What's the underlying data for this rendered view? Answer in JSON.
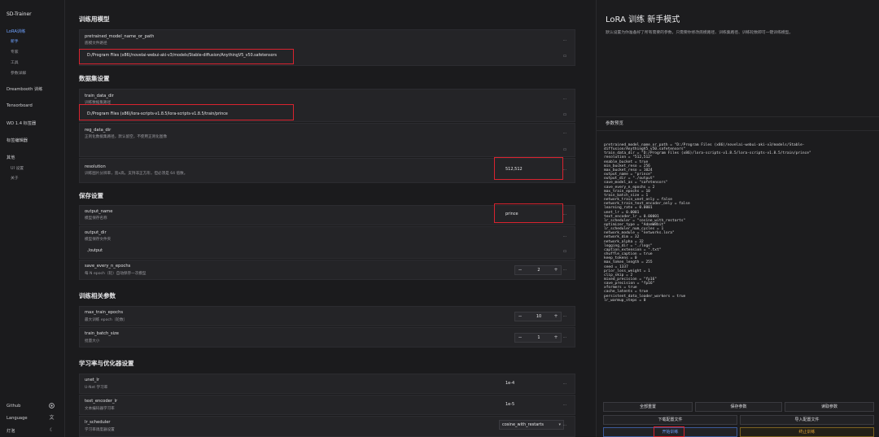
{
  "sidebar": {
    "brand": "SD-Trainer",
    "lora": "LoRA训练",
    "lora_subs": [
      "新手",
      "专家",
      "工具",
      "参数详解"
    ],
    "dreambooth": "Dreambooth 训练",
    "tensorboard": "Tensorboard",
    "wd": "WD 1.4 标签器",
    "tag_editor": "标签编辑器",
    "other": "其他",
    "other_subs": [
      "UI 设置",
      "关于"
    ],
    "github": "Github",
    "language": "Language",
    "theme": "灯泡"
  },
  "main": {
    "sections": {
      "model": "训练用模型",
      "dataset": "数据集设置",
      "save": "保存设置",
      "train": "训练相关参数",
      "lr": "学习率与优化器设置"
    },
    "pretrained": {
      "key": "pretrained_model_name_or_path",
      "desc": "底模文件路径",
      "value": "D:/Program Files (x86)/novelai-webui-aki-v3/models/Stable-diffusion/AnythingV5_v50.safetensors"
    },
    "train_data_dir": {
      "key": "train_data_dir",
      "desc": "训练数据集路径",
      "value": "D:/Program Files (x86)/lora-scripts-v1.8.5/lora-scripts-v1.8.5/train/prince"
    },
    "reg_data_dir": {
      "key": "reg_data_dir",
      "desc": "正则化数据集路径，默认留空，不使用正则化图像"
    },
    "resolution": {
      "key": "resolution",
      "desc": "训练图片分辨率，宽x高。支持非正方形，但必须是 64 倍数。",
      "value": "512,512"
    },
    "output_name": {
      "key": "output_name",
      "desc": "模型保存名称",
      "value": "prince"
    },
    "output_dir": {
      "key": "output_dir",
      "desc": "模型保存文件夹",
      "value": "./output"
    },
    "save_every": {
      "key": "save_every_n_epochs",
      "desc": "每 N epoch（轮）自动保存一次模型",
      "value": "2"
    },
    "max_epochs": {
      "key": "max_train_epochs",
      "desc": "最大训练 epoch（轮数）",
      "value": "10"
    },
    "batch_size": {
      "key": "train_batch_size",
      "desc": "批量大小",
      "value": "1"
    },
    "unet_lr": {
      "key": "unet_lr",
      "desc": "U-Net 学习率",
      "value": "1e-4"
    },
    "te_lr": {
      "key": "text_encoder_lr",
      "desc": "文本编码器学习率",
      "value": "1e-5"
    },
    "lr_scheduler": {
      "key": "lr_scheduler",
      "desc": "学习率调度器设置",
      "value": "cosine_with_restarts"
    }
  },
  "right": {
    "title": "LoRA 训练 新手模式",
    "desc": "默认设置为你准备好了所有需要的参数，只需要你修改底模路径、训练集路径、训练轮数即可一键训练模型。",
    "preview_title": "参数预览",
    "code": [
      "pretrained_model_name_or_path = \"D:/Program Files (x86)/novelai-webui-aki-v3/models/Stable-",
      "diffusion/AnythingV5_v50.safetensors\"",
      "train_data_dir = \"D:/Program Files (x86)/lora-scripts-v1.8.5/lora-scripts-v1.8.5/train/prince\"",
      "resolution = \"512,512\"",
      "enable_bucket = true",
      "min_bucket_reso = 256",
      "max_bucket_reso = 1024",
      "output_name = \"prince\"",
      "output_dir = \"./output\"",
      "save_model_as = \"safetensors\"",
      "save_every_n_epochs = 2",
      "max_train_epochs = 10",
      "train_batch_size = 1",
      "network_train_unet_only = false",
      "network_train_text_encoder_only = false",
      "learning_rate = 0.0001",
      "unet_lr = 0.0001",
      "text_encoder_lr = 0.00001",
      "lr_scheduler = \"cosine_with_restarts\"",
      "optimizer_type = \"AdamW8bit\"",
      "lr_scheduler_num_cycles = 1",
      "network_module = \"networks.lora\"",
      "network_dim = 32",
      "network_alpha = 32",
      "logging_dir = \"./logs\"",
      "caption_extension = \".txt\"",
      "shuffle_caption = true",
      "keep_tokens = 0",
      "max_token_length = 255",
      "seed = 1337",
      "prior_loss_weight = 1",
      "clip_skip = 2",
      "mixed_precision = \"fp16\"",
      "save_precision = \"fp16\"",
      "xformers = true",
      "cache_latents = true",
      "persistent_data_loader_workers = true",
      "lr_warmup_steps = 0"
    ],
    "buttons": {
      "reset": "全部重置",
      "save_params": "保存参数",
      "read_params": "读取参数",
      "download_config": "下载配置文件",
      "import_config": "导入配置文件",
      "start": "开始训练",
      "stop": "终止训练"
    }
  },
  "icons": {
    "github": "github-icon",
    "language": "translate-icon",
    "theme": "moon-icon",
    "folder": "folder-icon",
    "more": "more-icon"
  },
  "colors": {
    "accent": "#6ea1ff",
    "highlight": "#d9232f",
    "stop": "#e0a236"
  }
}
